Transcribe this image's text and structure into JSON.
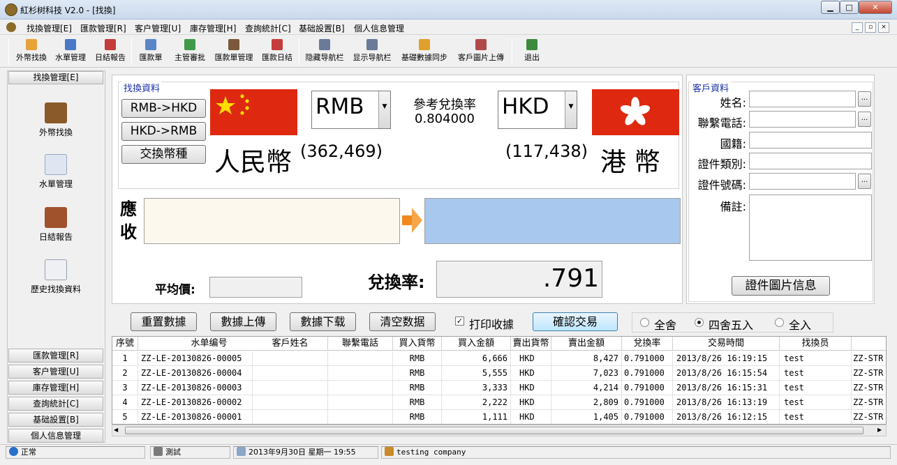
{
  "window": {
    "title": "紅杉树科技  V2.0 - [找換]"
  },
  "menu": [
    "找換管理[E]",
    "匯款管理[R]",
    "客户管理[U]",
    "庫存管理[H]",
    "查詢統計[C]",
    "基础設置[B]",
    "個人信息管理"
  ],
  "toolbar": [
    "外幣找換",
    "水單管理",
    "日結報告",
    "匯款單",
    "主管審批",
    "匯款單管理",
    "匯款日结",
    "隐藏导航栏",
    "显示导航栏",
    "基礎數據同步",
    "客戶圖片上傳",
    "退出"
  ],
  "sidebar": {
    "header": "找換管理[E]",
    "items": [
      "外幣找換",
      "水單管理",
      "日結報告",
      "歷史找換資料"
    ],
    "bottom": [
      "匯款管理[R]",
      "客户管理[U]",
      "庫存管理[H]",
      "查詢統計[C]",
      "基础設置[B]",
      "個人信息管理"
    ]
  },
  "exchange": {
    "group_label": "找換資料",
    "btn_rmb_hkd": "RMB->HKD",
    "btn_hkd_rmb": "HKD->RMB",
    "btn_swap": "交換幣種",
    "from_currency": "RMB",
    "to_currency": "HKD",
    "ref_rate_label": "參考兌換率",
    "ref_rate": "0.804000",
    "from_name": "人民幣",
    "from_stock": "(362,469)",
    "to_stock": "(117,438)",
    "to_name": "港 幣",
    "receive_label": "應收",
    "avg_price_label": "平均價:",
    "rate_label": "兌換率:",
    "rate_value": ".791"
  },
  "customer": {
    "group_label": "客戶資料",
    "name_label": "姓名:",
    "phone_label": "聯繫電話:",
    "nation_label": "國籍:",
    "idtype_label": "證件類別:",
    "idno_label": "證件號碼:",
    "remark_label": "備註:",
    "photo_button": "證件圖片信息",
    "dots": "..."
  },
  "actions": {
    "reset": "重置數據",
    "upload": "數據上傳",
    "download": "數據下载",
    "clear": "清空数据",
    "print_receipt": "打印收據",
    "confirm": "確認交易",
    "round_all": "全舍",
    "round_half": "四舍五入",
    "round_up": "全入",
    "rounding_selected": "四舍五入"
  },
  "table": {
    "columns": [
      "序號",
      "水单编号",
      "客戶姓名",
      "聯繫電話",
      "買入貨幣",
      "買入金額",
      "賣出貨幣",
      "賣出金額",
      "兌換率",
      "交易時間",
      "找換员"
    ],
    "rows": [
      [
        "1",
        "ZZ-LE-20130826-00005",
        "",
        "",
        "RMB",
        "6,666",
        "HKD",
        "8,427",
        "0.791000",
        "2013/8/26 16:19:15",
        "test",
        "ZZ-STR"
      ],
      [
        "2",
        "ZZ-LE-20130826-00004",
        "",
        "",
        "RMB",
        "5,555",
        "HKD",
        "7,023",
        "0.791000",
        "2013/8/26 16:15:54",
        "test",
        "ZZ-STR"
      ],
      [
        "3",
        "ZZ-LE-20130826-00003",
        "",
        "",
        "RMB",
        "3,333",
        "HKD",
        "4,214",
        "0.791000",
        "2013/8/26 16:15:31",
        "test",
        "ZZ-STR"
      ],
      [
        "4",
        "ZZ-LE-20130826-00002",
        "",
        "",
        "RMB",
        "2,222",
        "HKD",
        "2,809",
        "0.791000",
        "2013/8/26 16:13:19",
        "test",
        "ZZ-STR"
      ],
      [
        "5",
        "ZZ-LE-20130826-00001",
        "",
        "",
        "RMB",
        "1,111",
        "HKD",
        "1,405",
        "0.791000",
        "2013/8/26 16:12:15",
        "test",
        "ZZ-STR"
      ]
    ]
  },
  "status": {
    "state": "正常",
    "user": "測試",
    "datetime": "2013年9月30日  星期一   19:55",
    "company": "testing company"
  },
  "colors": {
    "cn_flag": "#de2910",
    "hk_flag": "#de2910",
    "to_amount_bg": "#a8c8ee",
    "from_amount_bg": "#fdf8ee"
  }
}
